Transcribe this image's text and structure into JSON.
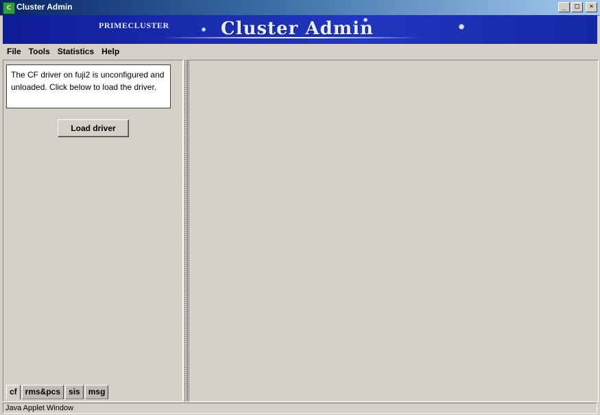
{
  "window": {
    "title": "Cluster Admin",
    "icon": "cluster-admin-app-icon",
    "controls": {
      "minimize": "_",
      "maximize": "□",
      "close": "×"
    }
  },
  "banner": {
    "subtitle": "PRIMECLUSTER",
    "title": "Cluster Admin"
  },
  "menu": {
    "items": [
      {
        "label": "File"
      },
      {
        "label": "Tools"
      },
      {
        "label": "Statistics"
      },
      {
        "label": "Help"
      }
    ]
  },
  "left_panel": {
    "message": "The CF driver on fuji2 is unconfigured and unloaded.  Click below to load the driver.",
    "load_button": "Load driver",
    "tabs": [
      {
        "label": "cf",
        "active": true
      },
      {
        "label": "rms&pcs",
        "active": false
      },
      {
        "label": "sis",
        "active": false
      },
      {
        "label": "msg",
        "active": false
      }
    ]
  },
  "status": {
    "text": "Java Applet Window"
  }
}
